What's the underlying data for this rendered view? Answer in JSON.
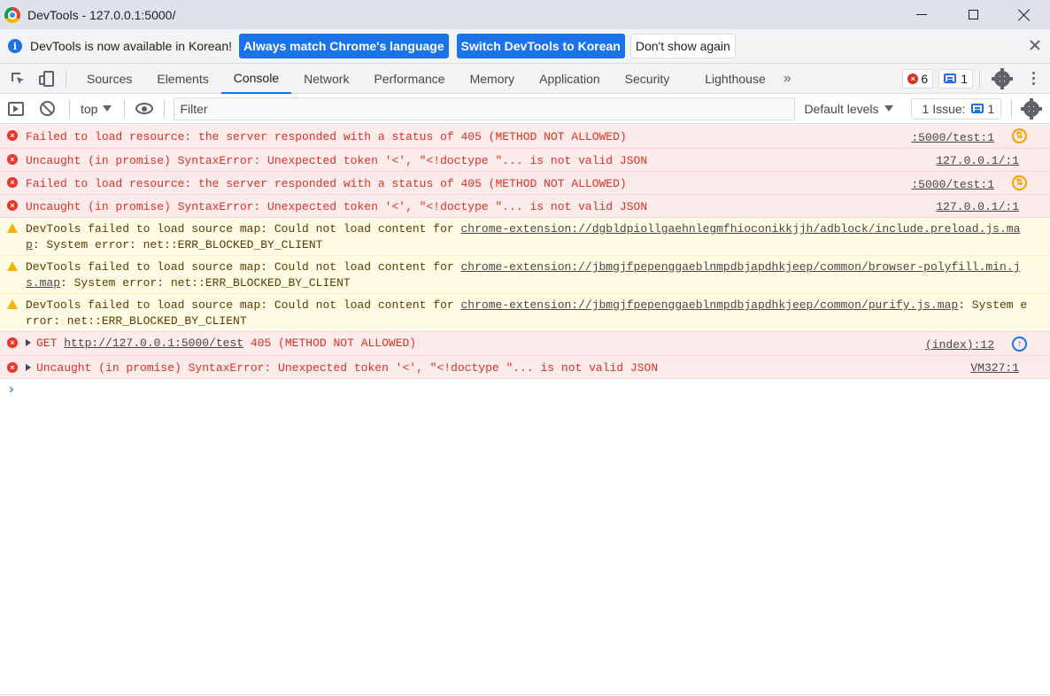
{
  "window": {
    "title": "DevTools - 127.0.0.1:5000/"
  },
  "infobar": {
    "text": "DevTools is now available in Korean!",
    "btn_match": "Always match Chrome's language",
    "btn_switch": "Switch DevTools to Korean",
    "btn_dismiss": "Don't show again"
  },
  "tabs": [
    "Sources",
    "Elements",
    "Console",
    "Network",
    "Performance",
    "Memory",
    "Application",
    "Security",
    "Lighthouse"
  ],
  "active_tab": "Console",
  "counters": {
    "errors": "6",
    "messages": "1"
  },
  "toolbar": {
    "context": "top",
    "filter_placeholder": "Filter",
    "levels": "Default levels",
    "issues_label": "1 Issue:",
    "issues_count": "1"
  },
  "messages": [
    {
      "level": "error",
      "text": "Failed to load resource: the server responded with a status of 405 (METHOD NOT ALLOWED)",
      "source": ":5000/test:1",
      "icon": "service-worker-icon"
    },
    {
      "level": "error",
      "text": "Uncaught (in promise) SyntaxError: Unexpected token '<', \"<!doctype \"... is not valid JSON",
      "source": "127.0.0.1/:1"
    },
    {
      "level": "error",
      "text": "Failed to load resource: the server responded with a status of 405 (METHOD NOT ALLOWED)",
      "source": ":5000/test:1",
      "icon": "service-worker-icon"
    },
    {
      "level": "error",
      "text": "Uncaught (in promise) SyntaxError: Unexpected token '<', \"<!doctype \"... is not valid JSON",
      "source": "127.0.0.1/:1"
    },
    {
      "level": "warning",
      "prefix": "DevTools failed to load source map: Could not load content for ",
      "link": "chrome-extension://dgbldpiollgaehnlegmfhioconikkjjh/adblock/include.preload.js.map",
      "suffix": ": System error: net::ERR_BLOCKED_BY_CLIENT"
    },
    {
      "level": "warning",
      "prefix": "DevTools failed to load source map: Could not load content for ",
      "link": "chrome-extension://jbmgjfpepenggaeblnmpdbjapdhkjeep/common/browser-polyfill.min.js.map",
      "suffix": ": System error: net::ERR_BLOCKED_BY_CLIENT"
    },
    {
      "level": "warning",
      "prefix": "DevTools failed to load source map: Could not load content for ",
      "link": "chrome-extension://jbmgjfpepenggaeblnmpdbjapdhkjeep/common/purify.js.map",
      "suffix": ": System error: net::ERR_BLOCKED_BY_CLIENT"
    },
    {
      "level": "error",
      "method": "GET",
      "url": "http://127.0.0.1:5000/test",
      "status": "405 (METHOD NOT ALLOWED)",
      "source": "(index):12",
      "icon": "network-icon"
    },
    {
      "level": "error",
      "text": "Uncaught (in promise) SyntaxError: Unexpected token '<', \"<!doctype \"... is not valid JSON",
      "source": "VM327:1"
    }
  ],
  "prompt": "›",
  "colors": {
    "accent": "#1a73e8",
    "error": "#dc3125",
    "error_bg": "#fcebeb",
    "warning_bg": "#fffbe5"
  }
}
